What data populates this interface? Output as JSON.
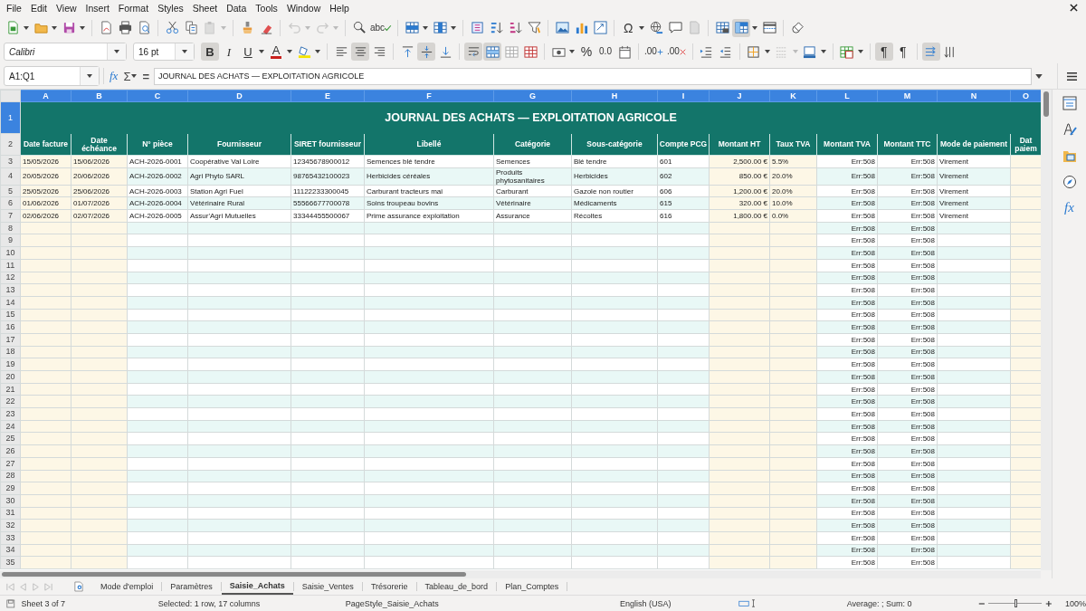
{
  "menu": [
    "File",
    "Edit",
    "View",
    "Insert",
    "Format",
    "Styles",
    "Sheet",
    "Data",
    "Tools",
    "Window",
    "Help"
  ],
  "standard_toolbar": {
    "spelling_label": "abc",
    "special_character_label": "Ω",
    "freeze": {
      "selected": true
    }
  },
  "formatting_toolbar": {
    "font_name": "Calibri",
    "font_size": "16 pt",
    "bold": {
      "label": "B",
      "selected": true
    },
    "italic": {
      "label": "I",
      "selected": false
    },
    "underline": {
      "label": "U",
      "selected": false
    },
    "font_color_label": "A",
    "alignment": [
      {
        "selected": false
      },
      {
        "selected": true
      },
      {
        "selected": false
      }
    ],
    "vertical_alignment": [
      {
        "selected": false
      },
      {
        "selected": true
      },
      {
        "selected": false
      }
    ],
    "wrap_text": {
      "selected": true
    },
    "merge": [
      {
        "selected": true
      },
      {
        "selected": false
      },
      {
        "selected": false
      }
    ],
    "percent_label": "%",
    "number_label": "0.0",
    "add_decimal_label": ".00",
    "delete_decimal_label": ".00",
    "paragraph_direction": [
      {
        "label": "¶",
        "selected": true
      },
      {
        "label": "¶",
        "selected": false
      }
    ],
    "text_orientation": [
      {
        "selected": true
      },
      {
        "selected": false
      }
    ]
  },
  "formula_bar": {
    "name_box": "A1:Q1",
    "function_wizard": "fx",
    "sum": "Σ",
    "equals": "=",
    "content": "JOURNAL DES ACHATS — EXPLOITATION AGRICOLE"
  },
  "sidebar": {
    "functions_label": "fx"
  },
  "sheet": {
    "title": "JOURNAL DES ACHATS — EXPLOITATION AGRICOLE",
    "columns": [
      {
        "letter": "A",
        "heading": "Date facture",
        "selected": true
      },
      {
        "letter": "B",
        "heading": "Date échéance",
        "selected": true
      },
      {
        "letter": "C",
        "heading": "N° pièce",
        "selected": true
      },
      {
        "letter": "D",
        "heading": "Fournisseur",
        "selected": true
      },
      {
        "letter": "E",
        "heading": "SIRET fournisseur",
        "selected": true
      },
      {
        "letter": "F",
        "heading": "Libellé",
        "selected": true
      },
      {
        "letter": "G",
        "heading": "Catégorie",
        "selected": true
      },
      {
        "letter": "H",
        "heading": "Sous-catégorie",
        "selected": true
      },
      {
        "letter": "I",
        "heading": "Compte PCG",
        "selected": true
      },
      {
        "letter": "J",
        "heading": "Montant HT",
        "selected": true
      },
      {
        "letter": "K",
        "heading": "Taux TVA",
        "selected": true
      },
      {
        "letter": "L",
        "heading": "Montant TVA",
        "selected": true
      },
      {
        "letter": "M",
        "heading": "Montant TTC",
        "selected": true
      },
      {
        "letter": "N",
        "heading": "Mode de paiement",
        "selected": true
      },
      {
        "letter": "O",
        "heading": "Dat paiem",
        "selected": true
      }
    ],
    "title_row": {
      "number": "1",
      "selected": true
    },
    "heading_row": {
      "number": "2",
      "selected": false
    },
    "rows": [
      {
        "number": "3",
        "selected": false,
        "cells": [
          "15/05/2026",
          "15/06/2026",
          "ACH-2026-0001",
          "Coopérative Val Loire",
          "12345678900012",
          "Semences blé tendre",
          "Semences",
          "Blé tendre",
          "601",
          "2,500.00 €",
          "5.5%",
          "Err:508",
          "Err:508",
          "Virement",
          null
        ]
      },
      {
        "number": "4",
        "selected": false,
        "cells": [
          "20/05/2026",
          "20/06/2026",
          "ACH-2026-0002",
          "Agri Phyto SARL",
          "98765432100023",
          "Herbicides céréales",
          "Produits phytosanitaires",
          "Herbicides",
          "602",
          "850.00 €",
          "20.0%",
          "Err:508",
          "Err:508",
          "Virement",
          null
        ]
      },
      {
        "number": "5",
        "selected": false,
        "cells": [
          "25/05/2026",
          "25/06/2026",
          "ACH-2026-0003",
          "Station Agri Fuel",
          "11122233300045",
          "Carburant tracteurs mai",
          "Carburant",
          "Gazole non routier",
          "606",
          "1,200.00 €",
          "20.0%",
          "Err:508",
          "Err:508",
          "Virement",
          null
        ]
      },
      {
        "number": "6",
        "selected": false,
        "cells": [
          "01/06/2026",
          "01/07/2026",
          "ACH-2026-0004",
          "Vétérinaire Rural",
          "55566677700078",
          "Soins troupeau bovins",
          "Vétérinaire",
          "Médicaments",
          "615",
          "320.00 €",
          "10.0%",
          "Err:508",
          "Err:508",
          "Virement",
          null
        ]
      },
      {
        "number": "7",
        "selected": false,
        "cells": [
          "02/06/2026",
          "02/07/2026",
          "ACH-2026-0005",
          "Assur'Agri Mutuelles",
          "33344455500067",
          "Prime assurance exploitation",
          "Assurance",
          "Récoltes",
          "616",
          "1,800.00 €",
          "0.0%",
          "Err:508",
          "Err:508",
          "Virement",
          null
        ]
      },
      {
        "number": "8",
        "selected": false,
        "cells": [
          null,
          null,
          null,
          null,
          null,
          null,
          null,
          null,
          null,
          null,
          null,
          "Err:508",
          "Err:508",
          null,
          null
        ]
      },
      {
        "number": "9",
        "selected": false,
        "cells": [
          null,
          null,
          null,
          null,
          null,
          null,
          null,
          null,
          null,
          null,
          null,
          "Err:508",
          "Err:508",
          null,
          null
        ]
      },
      {
        "number": "10",
        "selected": false,
        "cells": [
          null,
          null,
          null,
          null,
          null,
          null,
          null,
          null,
          null,
          null,
          null,
          "Err:508",
          "Err:508",
          null,
          null
        ]
      },
      {
        "number": "11",
        "selected": false,
        "cells": [
          null,
          null,
          null,
          null,
          null,
          null,
          null,
          null,
          null,
          null,
          null,
          "Err:508",
          "Err:508",
          null,
          null
        ]
      },
      {
        "number": "12",
        "selected": false,
        "cells": [
          null,
          null,
          null,
          null,
          null,
          null,
          null,
          null,
          null,
          null,
          null,
          "Err:508",
          "Err:508",
          null,
          null
        ]
      },
      {
        "number": "13",
        "selected": false,
        "cells": [
          null,
          null,
          null,
          null,
          null,
          null,
          null,
          null,
          null,
          null,
          null,
          "Err:508",
          "Err:508",
          null,
          null
        ]
      },
      {
        "number": "14",
        "selected": false,
        "cells": [
          null,
          null,
          null,
          null,
          null,
          null,
          null,
          null,
          null,
          null,
          null,
          "Err:508",
          "Err:508",
          null,
          null
        ]
      },
      {
        "number": "15",
        "selected": false,
        "cells": [
          null,
          null,
          null,
          null,
          null,
          null,
          null,
          null,
          null,
          null,
          null,
          "Err:508",
          "Err:508",
          null,
          null
        ]
      },
      {
        "number": "16",
        "selected": false,
        "cells": [
          null,
          null,
          null,
          null,
          null,
          null,
          null,
          null,
          null,
          null,
          null,
          "Err:508",
          "Err:508",
          null,
          null
        ]
      },
      {
        "number": "17",
        "selected": false,
        "cells": [
          null,
          null,
          null,
          null,
          null,
          null,
          null,
          null,
          null,
          null,
          null,
          "Err:508",
          "Err:508",
          null,
          null
        ]
      },
      {
        "number": "18",
        "selected": false,
        "cells": [
          null,
          null,
          null,
          null,
          null,
          null,
          null,
          null,
          null,
          null,
          null,
          "Err:508",
          "Err:508",
          null,
          null
        ]
      },
      {
        "number": "19",
        "selected": false,
        "cells": [
          null,
          null,
          null,
          null,
          null,
          null,
          null,
          null,
          null,
          null,
          null,
          "Err:508",
          "Err:508",
          null,
          null
        ]
      },
      {
        "number": "20",
        "selected": false,
        "cells": [
          null,
          null,
          null,
          null,
          null,
          null,
          null,
          null,
          null,
          null,
          null,
          "Err:508",
          "Err:508",
          null,
          null
        ]
      },
      {
        "number": "21",
        "selected": false,
        "cells": [
          null,
          null,
          null,
          null,
          null,
          null,
          null,
          null,
          null,
          null,
          null,
          "Err:508",
          "Err:508",
          null,
          null
        ]
      },
      {
        "number": "22",
        "selected": false,
        "cells": [
          null,
          null,
          null,
          null,
          null,
          null,
          null,
          null,
          null,
          null,
          null,
          "Err:508",
          "Err:508",
          null,
          null
        ]
      },
      {
        "number": "23",
        "selected": false,
        "cells": [
          null,
          null,
          null,
          null,
          null,
          null,
          null,
          null,
          null,
          null,
          null,
          "Err:508",
          "Err:508",
          null,
          null
        ]
      },
      {
        "number": "24",
        "selected": false,
        "cells": [
          null,
          null,
          null,
          null,
          null,
          null,
          null,
          null,
          null,
          null,
          null,
          "Err:508",
          "Err:508",
          null,
          null
        ]
      },
      {
        "number": "25",
        "selected": false,
        "cells": [
          null,
          null,
          null,
          null,
          null,
          null,
          null,
          null,
          null,
          null,
          null,
          "Err:508",
          "Err:508",
          null,
          null
        ]
      },
      {
        "number": "26",
        "selected": false,
        "cells": [
          null,
          null,
          null,
          null,
          null,
          null,
          null,
          null,
          null,
          null,
          null,
          "Err:508",
          "Err:508",
          null,
          null
        ]
      },
      {
        "number": "27",
        "selected": false,
        "cells": [
          null,
          null,
          null,
          null,
          null,
          null,
          null,
          null,
          null,
          null,
          null,
          "Err:508",
          "Err:508",
          null,
          null
        ]
      },
      {
        "number": "28",
        "selected": false,
        "cells": [
          null,
          null,
          null,
          null,
          null,
          null,
          null,
          null,
          null,
          null,
          null,
          "Err:508",
          "Err:508",
          null,
          null
        ]
      },
      {
        "number": "29",
        "selected": false,
        "cells": [
          null,
          null,
          null,
          null,
          null,
          null,
          null,
          null,
          null,
          null,
          null,
          "Err:508",
          "Err:508",
          null,
          null
        ]
      },
      {
        "number": "30",
        "selected": false,
        "cells": [
          null,
          null,
          null,
          null,
          null,
          null,
          null,
          null,
          null,
          null,
          null,
          "Err:508",
          "Err:508",
          null,
          null
        ]
      },
      {
        "number": "31",
        "selected": false,
        "cells": [
          null,
          null,
          null,
          null,
          null,
          null,
          null,
          null,
          null,
          null,
          null,
          "Err:508",
          "Err:508",
          null,
          null
        ]
      },
      {
        "number": "32",
        "selected": false,
        "cells": [
          null,
          null,
          null,
          null,
          null,
          null,
          null,
          null,
          null,
          null,
          null,
          "Err:508",
          "Err:508",
          null,
          null
        ]
      },
      {
        "number": "33",
        "selected": false,
        "cells": [
          null,
          null,
          null,
          null,
          null,
          null,
          null,
          null,
          null,
          null,
          null,
          "Err:508",
          "Err:508",
          null,
          null
        ]
      },
      {
        "number": "34",
        "selected": false,
        "cells": [
          null,
          null,
          null,
          null,
          null,
          null,
          null,
          null,
          null,
          null,
          null,
          "Err:508",
          "Err:508",
          null,
          null
        ]
      },
      {
        "number": "35",
        "selected": false,
        "cells": [
          null,
          null,
          null,
          null,
          null,
          null,
          null,
          null,
          null,
          null,
          null,
          "Err:508",
          "Err:508",
          null,
          null
        ]
      }
    ]
  },
  "tabs": [
    {
      "label": "Mode d'emploi",
      "selected": false
    },
    {
      "label": "Paramètres",
      "selected": false
    },
    {
      "label": "Saisie_Achats",
      "selected": true
    },
    {
      "label": "Saisie_Ventes",
      "selected": false
    },
    {
      "label": "Trésorerie",
      "selected": false
    },
    {
      "label": "Tableau_de_bord",
      "selected": false
    },
    {
      "label": "Plan_Comptes",
      "selected": false
    }
  ],
  "status": {
    "sheet": "Sheet 3 of 7",
    "selection": "Selected: 1 row, 17 columns",
    "page_style": "PageStyle_Saisie_Achats",
    "language": "English (USA)",
    "summary": "Average: ; Sum: 0",
    "zoom": {
      "level": 0.5,
      "percent": "100%"
    }
  }
}
